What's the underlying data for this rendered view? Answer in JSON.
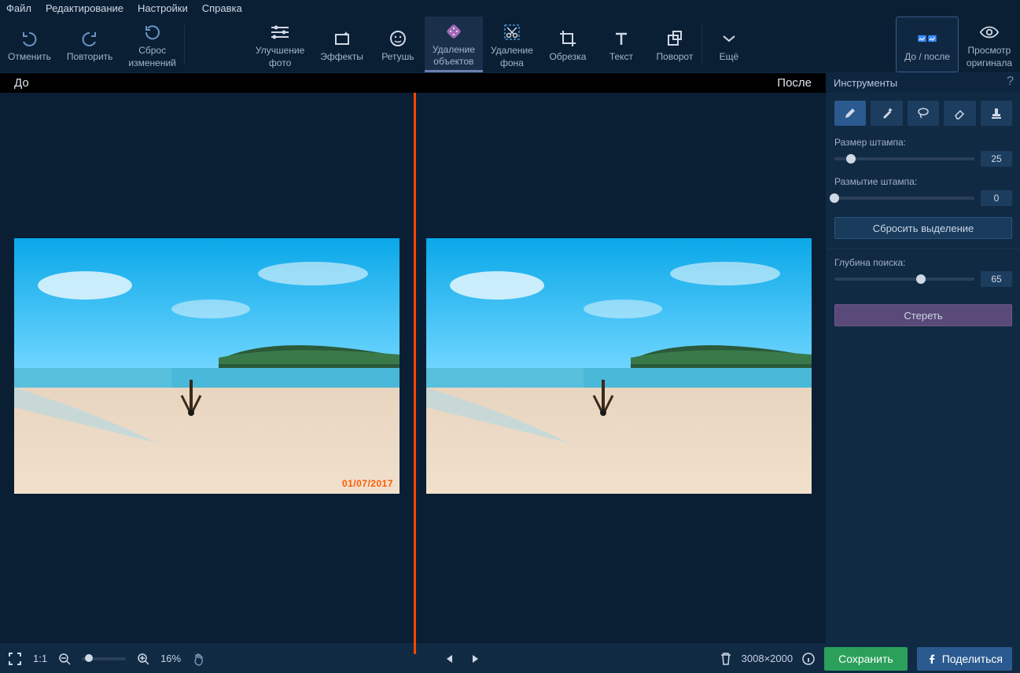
{
  "menu": {
    "file": "Файл",
    "edit": "Редактирование",
    "settings": "Настройки",
    "help": "Справка"
  },
  "toolbar": {
    "undo": "Отменить",
    "redo": "Повторить",
    "reset1": "Сброс",
    "reset2": "изменений",
    "enhance1": "Улучшение",
    "enhance2": "фото",
    "effects": "Эффекты",
    "retouch": "Ретушь",
    "removeObj1": "Удаление",
    "removeObj2": "объектов",
    "removeBg1": "Удаление",
    "removeBg2": "фона",
    "crop": "Обрезка",
    "text": "Текст",
    "rotate": "Поворот",
    "more": "Ещё",
    "beforeAfter": "До / после",
    "viewOrig1": "Просмотр",
    "viewOrig2": "оригинала"
  },
  "compare": {
    "before": "До",
    "after": "После"
  },
  "image": {
    "datestamp": "01/07/2017"
  },
  "panel": {
    "title": "Инструменты",
    "help": "?",
    "stampSize": "Размер штампа:",
    "stampSizeVal": "25",
    "stampBlur": "Размытие штампа:",
    "stampBlurVal": "0",
    "resetSel": "Сбросить выделение",
    "searchDepth": "Глубина поиска:",
    "searchDepthVal": "65",
    "erase": "Стереть"
  },
  "bottom": {
    "fit11": "1:1",
    "zoom": "16%",
    "dims": "3008×2000",
    "save": "Сохранить",
    "share": "Поделиться"
  }
}
